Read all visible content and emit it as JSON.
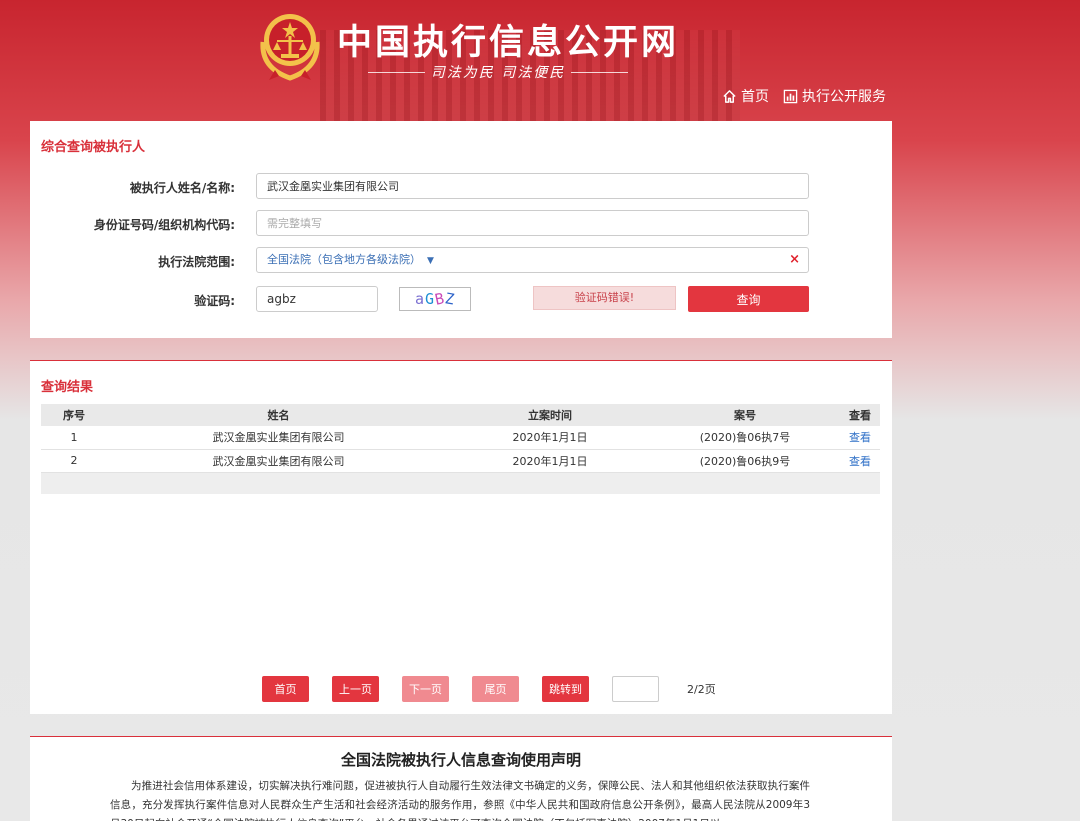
{
  "header": {
    "site_title": "中国执行信息公开网",
    "slogan": "司法为民  司法便民",
    "nav": [
      {
        "label": "首页",
        "icon": "home-icon"
      },
      {
        "label": "执行公开服务",
        "icon": "chart-icon"
      }
    ]
  },
  "search": {
    "section_title": "综合查询被执行人",
    "name_label": "被执行人姓名/名称:",
    "name_value": "武汉金凰实业集团有限公司",
    "id_label": "身份证号码/组织机构代码:",
    "id_placeholder": "需完整填写",
    "court_label": "执行法院范围:",
    "court_value": "全国法院（包含地方各级法院）",
    "captcha_label": "验证码:",
    "captcha_value": "agbz",
    "captcha_image_text": [
      "a",
      "G",
      "B",
      "Z"
    ],
    "captcha_error": "验证码错误!",
    "query_button": "查询"
  },
  "results": {
    "section_title": "查询结果",
    "columns": [
      "序号",
      "姓名",
      "立案时间",
      "案号",
      "查看"
    ],
    "rows": [
      {
        "no": "1",
        "name": "武汉金凰实业集团有限公司",
        "date": "2020年1月1日",
        "case": "(2020)鲁06执7号",
        "view": "查看"
      },
      {
        "no": "2",
        "name": "武汉金凰实业集团有限公司",
        "date": "2020年1月1日",
        "case": "(2020)鲁06执9号",
        "view": "查看"
      }
    ]
  },
  "pager": {
    "first": "首页",
    "prev": "上一页",
    "next": "下一页",
    "last": "尾页",
    "jump": "跳转到",
    "info": "2/2页"
  },
  "notice": {
    "title": "全国法院被执行人信息查询使用声明",
    "body": "为推进社会信用体系建设，切实解决执行难问题，促进被执行人自动履行生效法律文书确定的义务，保障公民、法人和其他组织依法获取执行案件信息，充分发挥执行案件信息对人民群众生产生活和社会经济活动的服务作用，参照《中华人民共和国政府信息公开条例》，最高人民法院从2009年3月30日起向社会开通“全国法院被执行人信息查询”平台，社会各界通过该平台可查询全国法院（不包括军事法院）2007年1月1日以"
  },
  "colors": {
    "brand_red": "#e3363f",
    "link_blue": "#2e6fc7"
  }
}
